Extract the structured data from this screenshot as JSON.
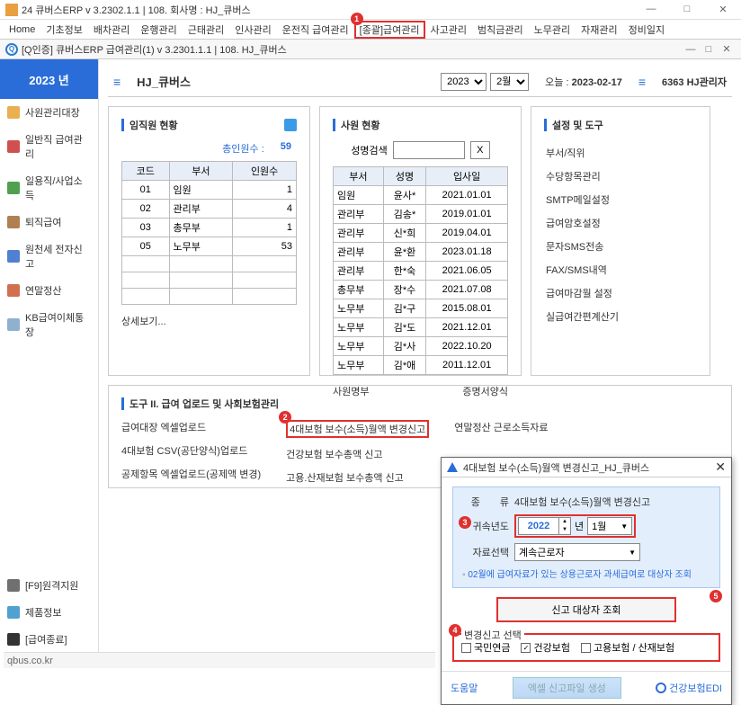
{
  "window": {
    "title": "24 큐버스ERP v 3.2302.1.1  | 108. 회사명 : HJ_큐버스"
  },
  "menubar": {
    "items": [
      "Home",
      "기초정보",
      "배차관리",
      "운행관리",
      "근태관리",
      "인사관리",
      "운전직 급여관리",
      "[종괄]급여관리",
      "사고관리",
      "범칙금관리",
      "노무관리",
      "자재관리",
      "정비일지"
    ],
    "highlight_index": 7
  },
  "subwin": {
    "title": "[Q인증] 큐버스ERP   급여관리(1)   v 3.2301.1.1  | 108. HJ_큐버스"
  },
  "sidebar": {
    "year_label": "2023 년",
    "items": [
      "사원관리대장",
      "일반직 급여관리",
      "일용직/사업소득",
      "퇴직급여",
      "원천세 전자신고",
      "연말정산",
      "KB급여이체통장"
    ],
    "bottom": [
      "[F9]원격지원",
      "제품정보",
      "[급여종료]"
    ]
  },
  "header": {
    "page_title": "HJ_큐버스",
    "year": "2023",
    "month": "2월",
    "today_label": "오늘 :",
    "today_value": "2023-02-17",
    "admin": "6363 HJ관리자"
  },
  "panel1": {
    "title": "임직원 현황",
    "total_label": "총인원수 :",
    "total_value": "59",
    "cols": [
      "코드",
      "부서",
      "인원수"
    ],
    "rows": [
      {
        "c": "01",
        "d": "임원",
        "n": "1"
      },
      {
        "c": "02",
        "d": "관리부",
        "n": "4"
      },
      {
        "c": "03",
        "d": "총무부",
        "n": "1"
      },
      {
        "c": "05",
        "d": "노무부",
        "n": "53"
      }
    ],
    "footer": "상세보기..."
  },
  "panel2": {
    "title": "사원 현황",
    "search_label": "성명검색",
    "cols": [
      "부서",
      "성명",
      "입사일"
    ],
    "rows": [
      {
        "d": "임원",
        "n": "윤사*",
        "j": "2021.01.01"
      },
      {
        "d": "관리부",
        "n": "김송*",
        "j": "2019.01.01"
      },
      {
        "d": "관리부",
        "n": "신*희",
        "j": "2019.04.01"
      },
      {
        "d": "관리부",
        "n": "윤*환",
        "j": "2023.01.18"
      },
      {
        "d": "관리부",
        "n": "한*숙",
        "j": "2021.06.05"
      },
      {
        "d": "총무부",
        "n": "장*수",
        "j": "2021.07.08"
      },
      {
        "d": "노무부",
        "n": "김*구",
        "j": "2015.08.01"
      },
      {
        "d": "노무부",
        "n": "김*도",
        "j": "2021.12.01"
      },
      {
        "d": "노무부",
        "n": "김*사",
        "j": "2022.10.20"
      },
      {
        "d": "노무부",
        "n": "김*애",
        "j": "2011.12.01"
      }
    ],
    "footer_left": "사원명부",
    "footer_right": "증명서양식"
  },
  "panel3": {
    "title": "설정 및 도구",
    "items": [
      "부서/직위",
      "수당항목관리",
      "SMTP메일설정",
      "급여암호설정",
      "문자SMS전송",
      "FAX/SMS내역",
      "급여마감월 설정",
      "실급여간편계산기"
    ]
  },
  "tools": {
    "title": "도구 II. 급여 업로드 및 사회보험관리",
    "col1": [
      "급여대장 엑셀업로드",
      "4대보험 CSV(공단양식)업로드",
      "공제항목 엑셀업로드(공제액 변경)"
    ],
    "col2": [
      "4대보험 보수(소득)월액 변경신고",
      "건강보험 보수총액 신고",
      "고용.산재보험 보수총액 신고"
    ],
    "col2_highlight_index": 0,
    "col3": [
      "연말정산 근로소득자료"
    ]
  },
  "dialog": {
    "title": "4대보험 보수(소득)월액 변경신고_HJ_큐버스",
    "type_label": "종　　류",
    "type_value": "4대보험 보수(소득)월액 변경신고",
    "year_label": "귀속년도",
    "year_value": "2022",
    "year_unit": "년",
    "month_value": "1월",
    "data_label": "자료선택",
    "data_value": "계속근로자",
    "note": "02월에 급여자료가 있는 상용근로자 과세급여로 대상자 조회",
    "query_btn": "신고 대상자 조회",
    "fieldset_title": "변경신고 선택",
    "checks": [
      {
        "label": "국민연금",
        "checked": false
      },
      {
        "label": "건강보험",
        "checked": true
      },
      {
        "label": "고용보험 / 산재보험",
        "checked": false
      }
    ],
    "help": "도움말",
    "excel_btn": "엑셀 신고파일 생성",
    "edi": "건강보험EDI"
  },
  "statusbar": {
    "text": "qbus.co.kr"
  },
  "callouts": {
    "c1": "1",
    "c2": "2",
    "c3": "3",
    "c4": "4",
    "c5": "5"
  }
}
